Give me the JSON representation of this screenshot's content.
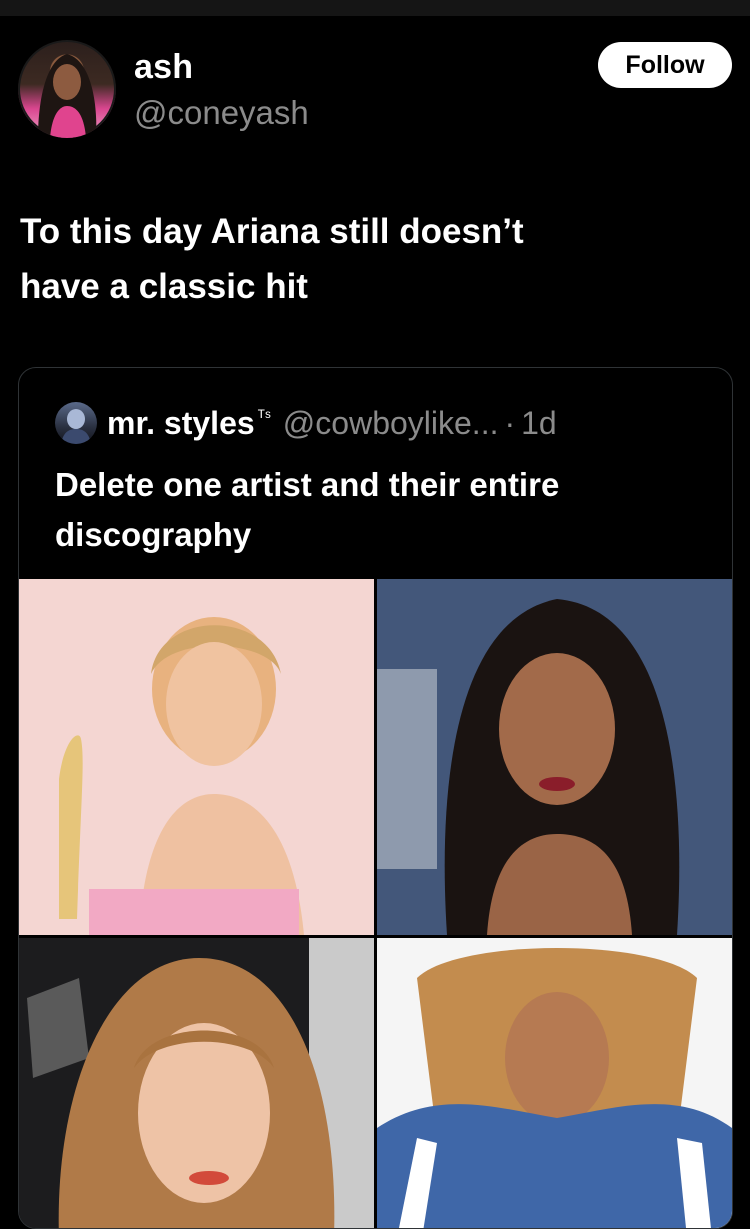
{
  "tweet": {
    "author": {
      "name": "ash",
      "handle": "@coneyash",
      "avatar_icon": "profile-photo"
    },
    "follow_label": "Follow",
    "text_line1": "To this day Ariana still doesn’t",
    "text_line2": "have a classic hit"
  },
  "quoted": {
    "name": "mr. styles",
    "name_suffix": "ᵀˢ",
    "handle": "@cowboylike...",
    "separator": "·",
    "time": "1d",
    "text_line1": "Delete one artist and their entire",
    "text_line2": "discography",
    "images": [
      {
        "icon": "portrait-photo",
        "position": "top-left"
      },
      {
        "icon": "portrait-photo",
        "position": "top-right"
      },
      {
        "icon": "portrait-photo",
        "position": "bottom-left"
      },
      {
        "icon": "portrait-photo",
        "position": "bottom-right"
      }
    ]
  },
  "colors": {
    "background": "#000000",
    "secondary_text": "#8b8b8b",
    "border": "#2f3336",
    "follow_bg": "#ffffff"
  }
}
